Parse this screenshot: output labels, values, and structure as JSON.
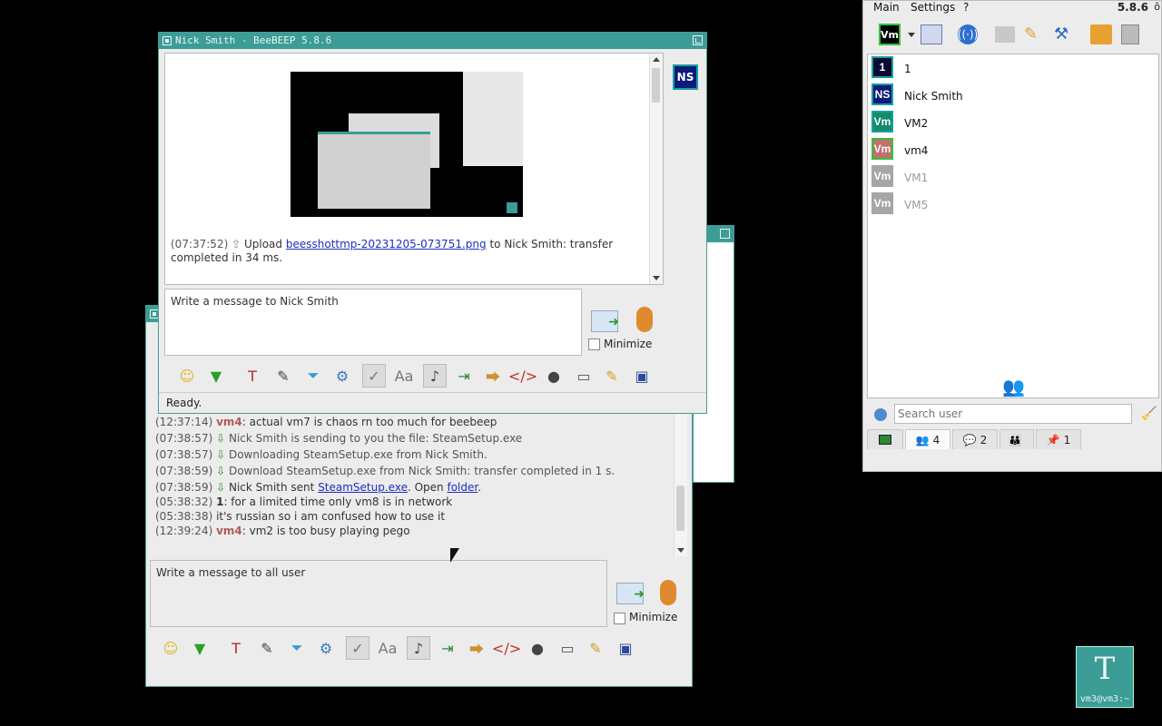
{
  "private_chat": {
    "title": "Nick Smith - BeeBEEP 5.8.6",
    "avatar_initials": "NS",
    "message_ts": "(07:37:52)",
    "message_pre": "Upload",
    "message_link": "beesshottmp-20231205-073751.png",
    "message_post": "to Nick Smith: transfer",
    "message_cont": "completed in 34 ms.",
    "compose_placeholder": "Write a message to Nick Smith",
    "minimize_label": "Minimize",
    "status": "Ready."
  },
  "group_chat": {
    "messages": [
      {
        "ts": "(12:37:14)",
        "nick": "vm4",
        "text": ": actual vm7 is chaos rn too much for beebeep"
      },
      {
        "ts": "(07:38:57)",
        "text": "Nick Smith is sending to you the file: SteamSetup.exe"
      },
      {
        "ts": "(07:38:57)",
        "text": "Downloading SteamSetup.exe from Nick Smith."
      },
      {
        "ts": "(07:38:59)",
        "text": "Download SteamSetup.exe from Nick Smith: transfer completed in 1 s."
      },
      {
        "ts": "(07:38:59)",
        "text_pre": "Nick Smith sent",
        "link1": "SteamSetup.exe",
        "mid": ". Open",
        "link2": "folder",
        "end": "."
      },
      {
        "ts": "(05:38:32)",
        "nick_bold": "1",
        "text": ": for a limited time only vm8 is in network"
      },
      {
        "ts": "(05:38:38)",
        "text": "it's russian so i am confused how to use it"
      },
      {
        "ts": "(12:39:24)",
        "nick": "vm4",
        "text": ": vm2 is too busy playing pego"
      }
    ],
    "compose_placeholder": "Write a message to all user",
    "minimize_label": "Minimize"
  },
  "main_window": {
    "menu": [
      "Main",
      "Settings",
      "?"
    ],
    "version": "5.8.6",
    "status_avatar": "Vm",
    "users": [
      {
        "initials": "1",
        "name": "1",
        "color": "#0a0a30",
        "border": "#18a0a0",
        "online": true
      },
      {
        "initials": "NS",
        "name": "Nick Smith",
        "color": "#0c1a7a",
        "border": "#18a0a0",
        "online": true
      },
      {
        "initials": "Vm",
        "name": "VM2",
        "color": "#158a6a",
        "border": "#18a0a0",
        "online": true
      },
      {
        "initials": "Vm",
        "name": "vm4",
        "color": "#c07070",
        "border": "#37c037",
        "online": true
      },
      {
        "initials": "Vm",
        "name": "VM1",
        "color": "#a6a6a6",
        "border": "#a6a6a6",
        "online": false
      },
      {
        "initials": "Vm",
        "name": "VM5",
        "color": "#a6a6a6",
        "border": "#a6a6a6",
        "online": false
      }
    ],
    "search_placeholder": "Search user",
    "tabs": [
      "4",
      "2",
      "",
      "1"
    ]
  },
  "desktop_icon": {
    "glyph": "T",
    "label": "vm3@vm3:~"
  }
}
